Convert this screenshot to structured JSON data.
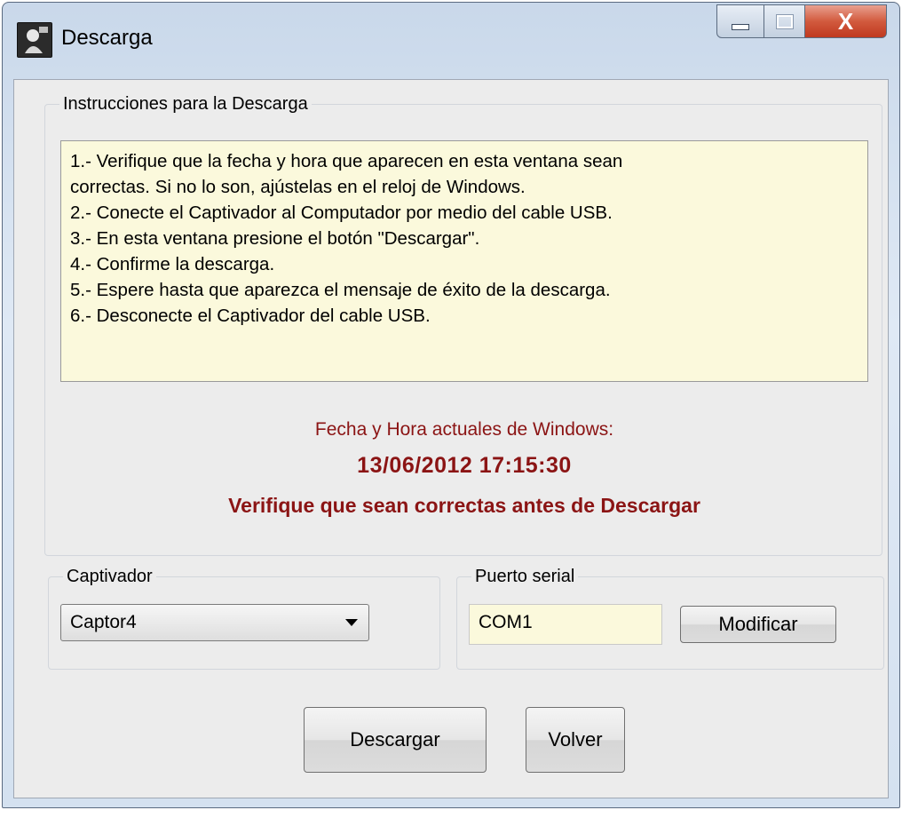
{
  "window": {
    "title": "Descarga",
    "close_glyph": "X",
    "icons": {
      "app": "app-icon",
      "minimize": "minimize-icon",
      "maximize": "maximize-icon",
      "close": "close-icon"
    }
  },
  "instructions": {
    "legend": "Instrucciones para la Descarga",
    "lines": [
      "1.- Verifique que la fecha y hora que aparecen en esta ventana sean",
      "correctas. Si no lo son, ajústelas en el reloj de Windows.",
      "2.- Conecte el Captivador al Computador por medio del cable USB.",
      "3.- En esta ventana presione el botón \"Descargar\".",
      "4.- Confirme la descarga.",
      "5.- Espere hasta que aparezca el mensaje de éxito de la descarga.",
      "6.- Desconecte el Captivador del cable USB."
    ],
    "fecha_label": "Fecha y Hora actuales de Windows:",
    "fecha_value": "13/06/2012 17:15:30",
    "fecha_warning": "Verifique que sean correctas antes de Descargar"
  },
  "captivador": {
    "legend": "Captivador",
    "selected": "Captor4"
  },
  "puerto": {
    "legend": "Puerto serial",
    "value": "COM1",
    "modify_label": "Modificar"
  },
  "actions": {
    "descargar_label": "Descargar",
    "volver_label": "Volver"
  },
  "colors": {
    "accent_text": "#8b1414",
    "notice_bg": "#fbf9dc",
    "close_button": "#c84a2e"
  }
}
